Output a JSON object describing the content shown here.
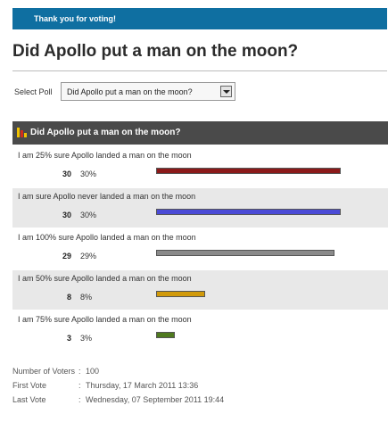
{
  "banner": {
    "message": "Thank you for voting!"
  },
  "page": {
    "title": "Did Apollo put a man on the moon?"
  },
  "select": {
    "label": "Select Poll",
    "value": "Did Apollo put a man on the moon?"
  },
  "poll": {
    "question": "Did Apollo put a man on the moon?",
    "answers": [
      {
        "label": "I am 25% sure Apollo landed a man on the moon",
        "votes": "30",
        "percent": "30%",
        "share": 30,
        "color": "#8b1a1a"
      },
      {
        "label": "I am sure Apollo never landed a man on the moon",
        "votes": "30",
        "percent": "30%",
        "share": 30,
        "color": "#4b4bd6"
      },
      {
        "label": "I am 100% sure Apollo landed a man on the moon",
        "votes": "29",
        "percent": "29%",
        "share": 29,
        "color": "#8a8a8a"
      },
      {
        "label": "I am 50% sure Apollo landed a man on the moon",
        "votes": "8",
        "percent": "8%",
        "share": 8,
        "color": "#d19a0a"
      },
      {
        "label": "I am 75% sure Apollo landed a man on the moon",
        "votes": "3",
        "percent": "3%",
        "share": 3,
        "color": "#4f7a1f"
      }
    ]
  },
  "stats": {
    "voters_label": "Number of Voters",
    "voters": "100",
    "first_label": "First Vote",
    "first": "Thursday, 17 March 2011 13:36",
    "last_label": "Last Vote",
    "last": "Wednesday, 07 September 2011 19:44"
  }
}
